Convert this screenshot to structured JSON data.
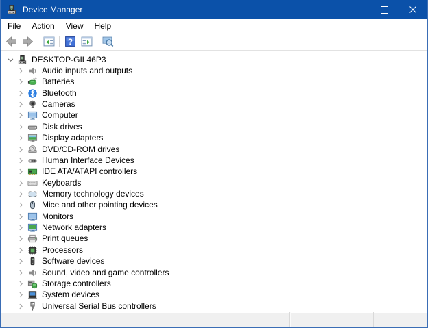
{
  "window": {
    "title": "Device Manager",
    "controls": [
      {
        "name": "minimize",
        "icon": "minimize-icon"
      },
      {
        "name": "maximize",
        "icon": "maximize-icon"
      },
      {
        "name": "close",
        "icon": "close-icon"
      }
    ]
  },
  "menu": {
    "items": [
      "File",
      "Action",
      "View",
      "Help"
    ]
  },
  "toolbar": {
    "help_glyph": "?",
    "buttons": [
      {
        "type": "btn",
        "name": "back",
        "symbol": "t-back"
      },
      {
        "type": "btn",
        "name": "forward",
        "symbol": "t-fwd"
      },
      {
        "type": "sep"
      },
      {
        "type": "btn",
        "name": "show-console-tree",
        "symbol": "t-tree"
      },
      {
        "type": "sep"
      },
      {
        "type": "btn",
        "name": "help",
        "symbol": "t-help"
      },
      {
        "type": "btn",
        "name": "show-action-pane",
        "symbol": "t-pane"
      },
      {
        "type": "sep"
      },
      {
        "type": "btn",
        "name": "scan-hardware-changes",
        "symbol": "t-scan"
      }
    ]
  },
  "tree": {
    "root": {
      "label": "DESKTOP-GIL46P3",
      "icon": "computer-root",
      "expanded": true
    },
    "items": [
      {
        "label": "Audio inputs and outputs",
        "icon": "speaker"
      },
      {
        "label": "Batteries",
        "icon": "battery"
      },
      {
        "label": "Bluetooth",
        "icon": "bluetooth"
      },
      {
        "label": "Cameras",
        "icon": "camera"
      },
      {
        "label": "Computer",
        "icon": "monitor"
      },
      {
        "label": "Disk drives",
        "icon": "disk"
      },
      {
        "label": "Display adapters",
        "icon": "display"
      },
      {
        "label": "DVD/CD-ROM drives",
        "icon": "dvd"
      },
      {
        "label": "Human Interface Devices",
        "icon": "hid"
      },
      {
        "label": "IDE ATA/ATAPI controllers",
        "icon": "ide"
      },
      {
        "label": "Keyboards",
        "icon": "keyboard"
      },
      {
        "label": "Memory technology devices",
        "icon": "memory"
      },
      {
        "label": "Mice and other pointing devices",
        "icon": "mouse"
      },
      {
        "label": "Monitors",
        "icon": "monitor"
      },
      {
        "label": "Network adapters",
        "icon": "network"
      },
      {
        "label": "Print queues",
        "icon": "printer"
      },
      {
        "label": "Processors",
        "icon": "processor"
      },
      {
        "label": "Software devices",
        "icon": "software"
      },
      {
        "label": "Sound, video and game controllers",
        "icon": "speaker"
      },
      {
        "label": "Storage controllers",
        "icon": "storage"
      },
      {
        "label": "System devices",
        "icon": "system"
      },
      {
        "label": "Universal Serial Bus controllers",
        "icon": "usb"
      }
    ]
  },
  "statusbar": {
    "sections": [
      "",
      "",
      ""
    ]
  },
  "colors": {
    "titlebar": "#0b51a9",
    "border": "#3a6db5",
    "statusbar": "#f0f0f0"
  }
}
